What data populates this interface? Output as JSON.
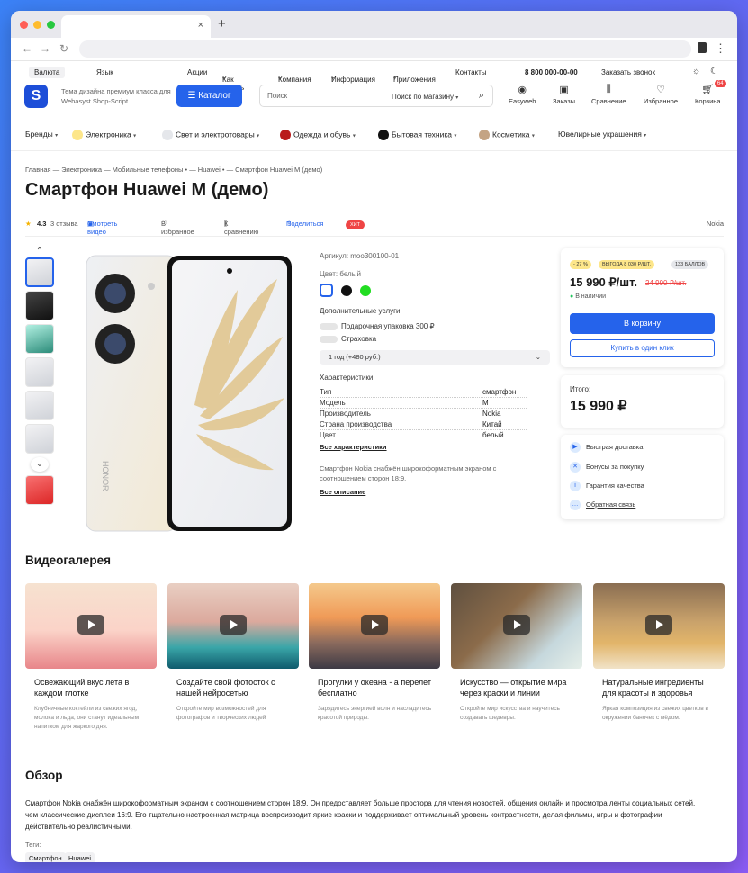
{
  "browser": {
    "tab_title": "",
    "new_tab": "+",
    "close": "×"
  },
  "util": {
    "currency": "Валюта",
    "language": "Язык",
    "links": [
      "Акции",
      "Как купить",
      "Компания",
      "Информация",
      "Приложения",
      "Контакты"
    ],
    "phone": "8 800 000-00-00",
    "callback": "Заказать звонок"
  },
  "header": {
    "logo": "S",
    "tagline": "Тема дизайна премиум класса для Webasyst Shop-Script",
    "catalog": "Каталог",
    "search_placeholder": "Поиск",
    "search_scope": "Поиск по магазину",
    "icons": [
      {
        "label": "Easyweb",
        "icon": "user-icon"
      },
      {
        "label": "Заказы",
        "icon": "orders-icon"
      },
      {
        "label": "Сравнение",
        "icon": "compare-icon"
      },
      {
        "label": "Избранное",
        "icon": "heart-icon"
      },
      {
        "label": "Корзина",
        "icon": "cart-icon",
        "badge": "64"
      }
    ]
  },
  "categories": [
    "Бренды",
    "Электроника",
    "Свет и электротовары",
    "Одежда и обувь",
    "Бытовая техника",
    "Косметика",
    "Ювелирные украшения"
  ],
  "breadcrumb": "Главная  —  Электроника  —  Мобильные телефоны  •  —  Huawei  •  —  Смартфон Huawei M (демо)",
  "product": {
    "title": "Смартфон Huawei M (демо)",
    "rating": "4.3",
    "reviews": "3 отзыва",
    "video": "Смотреть видео",
    "favorite": "В избранное",
    "compare": "К сравнению",
    "share": "Поделиться",
    "hit": "ХИТ",
    "brand": "Nokia",
    "sku": "Артикул: moo300100-01",
    "color_label": "Цвет: белый",
    "colors": [
      "#ffffff",
      "#111111",
      "#22dd22"
    ],
    "services_label": "Дополнительные услуги:",
    "services": [
      "Подарочная упаковка 300 ₽",
      "Страховка"
    ],
    "warranty_option": "1 год (+480 руб.)",
    "specs_title": "Характеристики",
    "specs": [
      {
        "k": "Тип",
        "v": "смартфон"
      },
      {
        "k": "Модель",
        "v": "M"
      },
      {
        "k": "Производитель",
        "v": "Nokia"
      },
      {
        "k": "Страна производства",
        "v": "Китай"
      },
      {
        "k": "Цвет",
        "v": "белый"
      }
    ],
    "all_specs": "Все характеристики",
    "short_desc": "Смартфон Nokia снабжён широкоформатным экраном с соотношением сторон 18:9.",
    "all_desc": "Все описание"
  },
  "buy": {
    "discount": "- 27 %",
    "benefit": "ВЫГОДА 8 030 Р/ШТ.",
    "points": "133 БАЛЛОВ",
    "price": "15 990 ₽/шт.",
    "old_price": "24 990 ₽/шт.",
    "stock": "В наличии",
    "cart_btn": "В корзину",
    "one_click": "Купить в один клик",
    "total_label": "Итого:",
    "total": "15 990 ₽",
    "features": [
      "Быстрая доставка",
      "Бонусы за покупку",
      "Гарантия качества",
      "Обратная связь"
    ]
  },
  "gallery": {
    "title": "Видеогалерея",
    "items": [
      {
        "title": "Освежающий вкус лета в каждом глотке",
        "desc": "Клубничные коктейли из свежих ягод, молока и льда, они станут идеальным напитком для жаркого дня."
      },
      {
        "title": "Создайте свой фотосток с нашей нейросетью",
        "desc": "Откройте мир возможностей для фотографов и творческих людей"
      },
      {
        "title": "Прогулки у океана - а перелет бесплатно",
        "desc": "Зарядитесь энергией волн и насладитесь красотой природы."
      },
      {
        "title": "Искусство — открытие мира через краски и линии",
        "desc": "Откройте мир искусства и научитесь создавать шедевры."
      },
      {
        "title": "Натуральные ингредиенты для красоты и здоровья",
        "desc": "Яркая композиция из свежих цветков в окружении баночек с мёдом."
      }
    ]
  },
  "overview": {
    "title": "Обзор",
    "text": "Смартфон Nokia снабжён широкоформатным экраном с соотношением сторон 18:9. Он предоставляет больше простора для чтения новостей, общения онлайн и просмотра ленты социальных сетей, чем классические дисплеи 16:9. Его тщательно настроенная матрица воспроизводит яркие краски и поддерживает оптимальный уровень контрастности, делая фильмы, игры и фотографии действительно реалистичными.",
    "tags_label": "Теги:",
    "tags": [
      "Смартфон",
      "Huawei"
    ]
  }
}
